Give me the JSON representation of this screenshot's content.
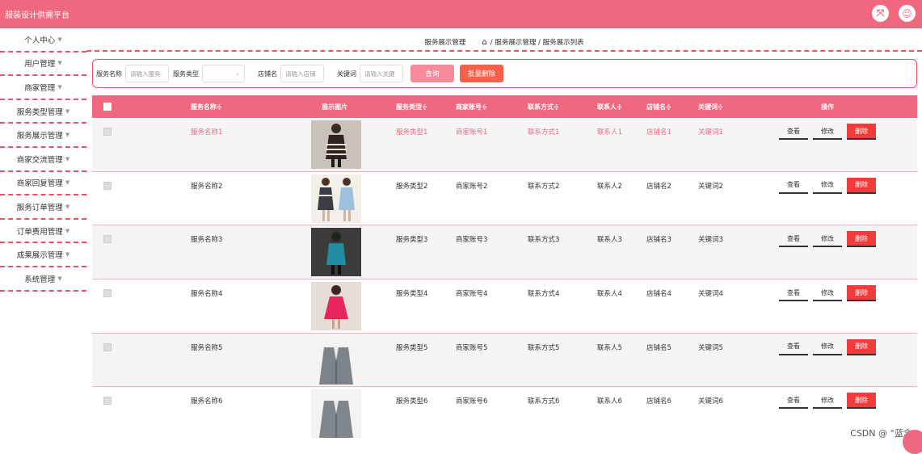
{
  "app": {
    "title": "服装设计供需平台"
  },
  "sidebar": {
    "items": [
      {
        "label": "个人中心"
      },
      {
        "label": "用户管理"
      },
      {
        "label": "商家管理"
      },
      {
        "label": "服务类型管理"
      },
      {
        "label": "服务展示管理"
      },
      {
        "label": "商家交流管理"
      },
      {
        "label": "商家回复管理"
      },
      {
        "label": "服务订单管理"
      },
      {
        "label": "订单费用管理"
      },
      {
        "label": "成果展示管理"
      },
      {
        "label": "系统管理"
      }
    ]
  },
  "breadcrumb": {
    "section": "服务展示管理",
    "path": "/ 服务展示管理 / 服务展示列表"
  },
  "search": {
    "name_label": "服务名称",
    "name_placeholder": "请输入服务",
    "type_label": "服务类型",
    "type_value": "",
    "shop_label": "店铺名",
    "shop_placeholder": "请输入店铺",
    "kw_label": "关键词",
    "kw_placeholder": "请输入关键",
    "query_label": "查询",
    "batch_delete_label": "批量删除"
  },
  "table": {
    "headers": {
      "name": "服务名称≑",
      "image": "展示图片",
      "type": "服务类型≑",
      "account": "商家账号≑",
      "contact": "联系方式≑",
      "person": "联系人≑",
      "shop": "店铺名≑",
      "keyword": "关键词≑",
      "ops": "操作"
    },
    "rows": [
      {
        "name": "服务名称1",
        "type": "服务类型1",
        "account": "商家账号1",
        "contact": "联系方式1",
        "person": "联系人1",
        "shop": "店铺名1",
        "keyword": "关键词1"
      },
      {
        "name": "服务名称2",
        "type": "服务类型2",
        "account": "商家账号2",
        "contact": "联系方式2",
        "person": "联系人2",
        "shop": "店铺名2",
        "keyword": "关键词2"
      },
      {
        "name": "服务名称3",
        "type": "服务类型3",
        "account": "商家账号3",
        "contact": "联系方式3",
        "person": "联系人3",
        "shop": "店铺名3",
        "keyword": "关键词3"
      },
      {
        "name": "服务名称4",
        "type": "服务类型4",
        "account": "商家账号4",
        "contact": "联系方式4",
        "person": "联系人4",
        "shop": "店铺名4",
        "keyword": "关键词4"
      },
      {
        "name": "服务名称5",
        "type": "服务类型5",
        "account": "商家账号5",
        "contact": "联系方式5",
        "person": "联系人5",
        "shop": "店铺名5",
        "keyword": "关键词5"
      },
      {
        "name": "服务名称6",
        "type": "服务类型6",
        "account": "商家账号6",
        "contact": "联系方式6",
        "person": "联系人6",
        "shop": "店铺名6",
        "keyword": "关键词6"
      }
    ],
    "ops": {
      "view": "查看",
      "edit": "修改",
      "delete": "删除"
    }
  },
  "watermark": "CSDN @ °蓝念",
  "colors": {
    "accent": "#f0687f",
    "danger": "#f23b3b"
  }
}
